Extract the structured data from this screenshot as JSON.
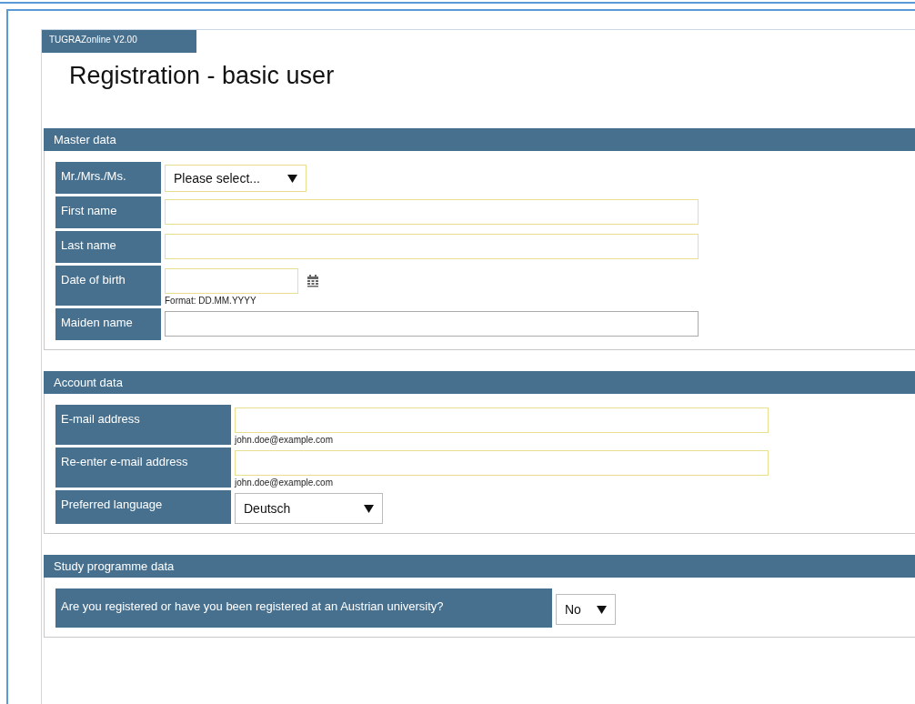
{
  "app_tab": "TUGRAZonline V2.00",
  "title": "Registration - basic user",
  "sections": [
    {
      "heading": "Master data",
      "rows": [
        {
          "label": "Mr./Mrs./Ms.",
          "kind": "select",
          "value": "Please select...",
          "required": true
        },
        {
          "label": "First name",
          "kind": "text",
          "required": true
        },
        {
          "label": "Last name",
          "kind": "text",
          "required": true
        },
        {
          "label": "Date of birth",
          "kind": "date",
          "required": true,
          "hint": "Format: DD.MM.YYYY"
        },
        {
          "label": "Maiden name",
          "kind": "text",
          "required": false
        }
      ]
    },
    {
      "heading": "Account data",
      "rows": [
        {
          "label": "E-mail address",
          "kind": "text",
          "required": true,
          "hint": "john.doe@example.com"
        },
        {
          "label": "Re-enter e-mail address",
          "kind": "text",
          "required": true,
          "hint": "john.doe@example.com"
        },
        {
          "label": "Preferred language",
          "kind": "select",
          "value": "Deutsch",
          "required": false
        }
      ]
    },
    {
      "heading": "Study programme data",
      "rows": [
        {
          "label": "Are you registered or have you been registered at an Austrian university?",
          "kind": "select",
          "value": "No",
          "required": false
        }
      ]
    }
  ]
}
